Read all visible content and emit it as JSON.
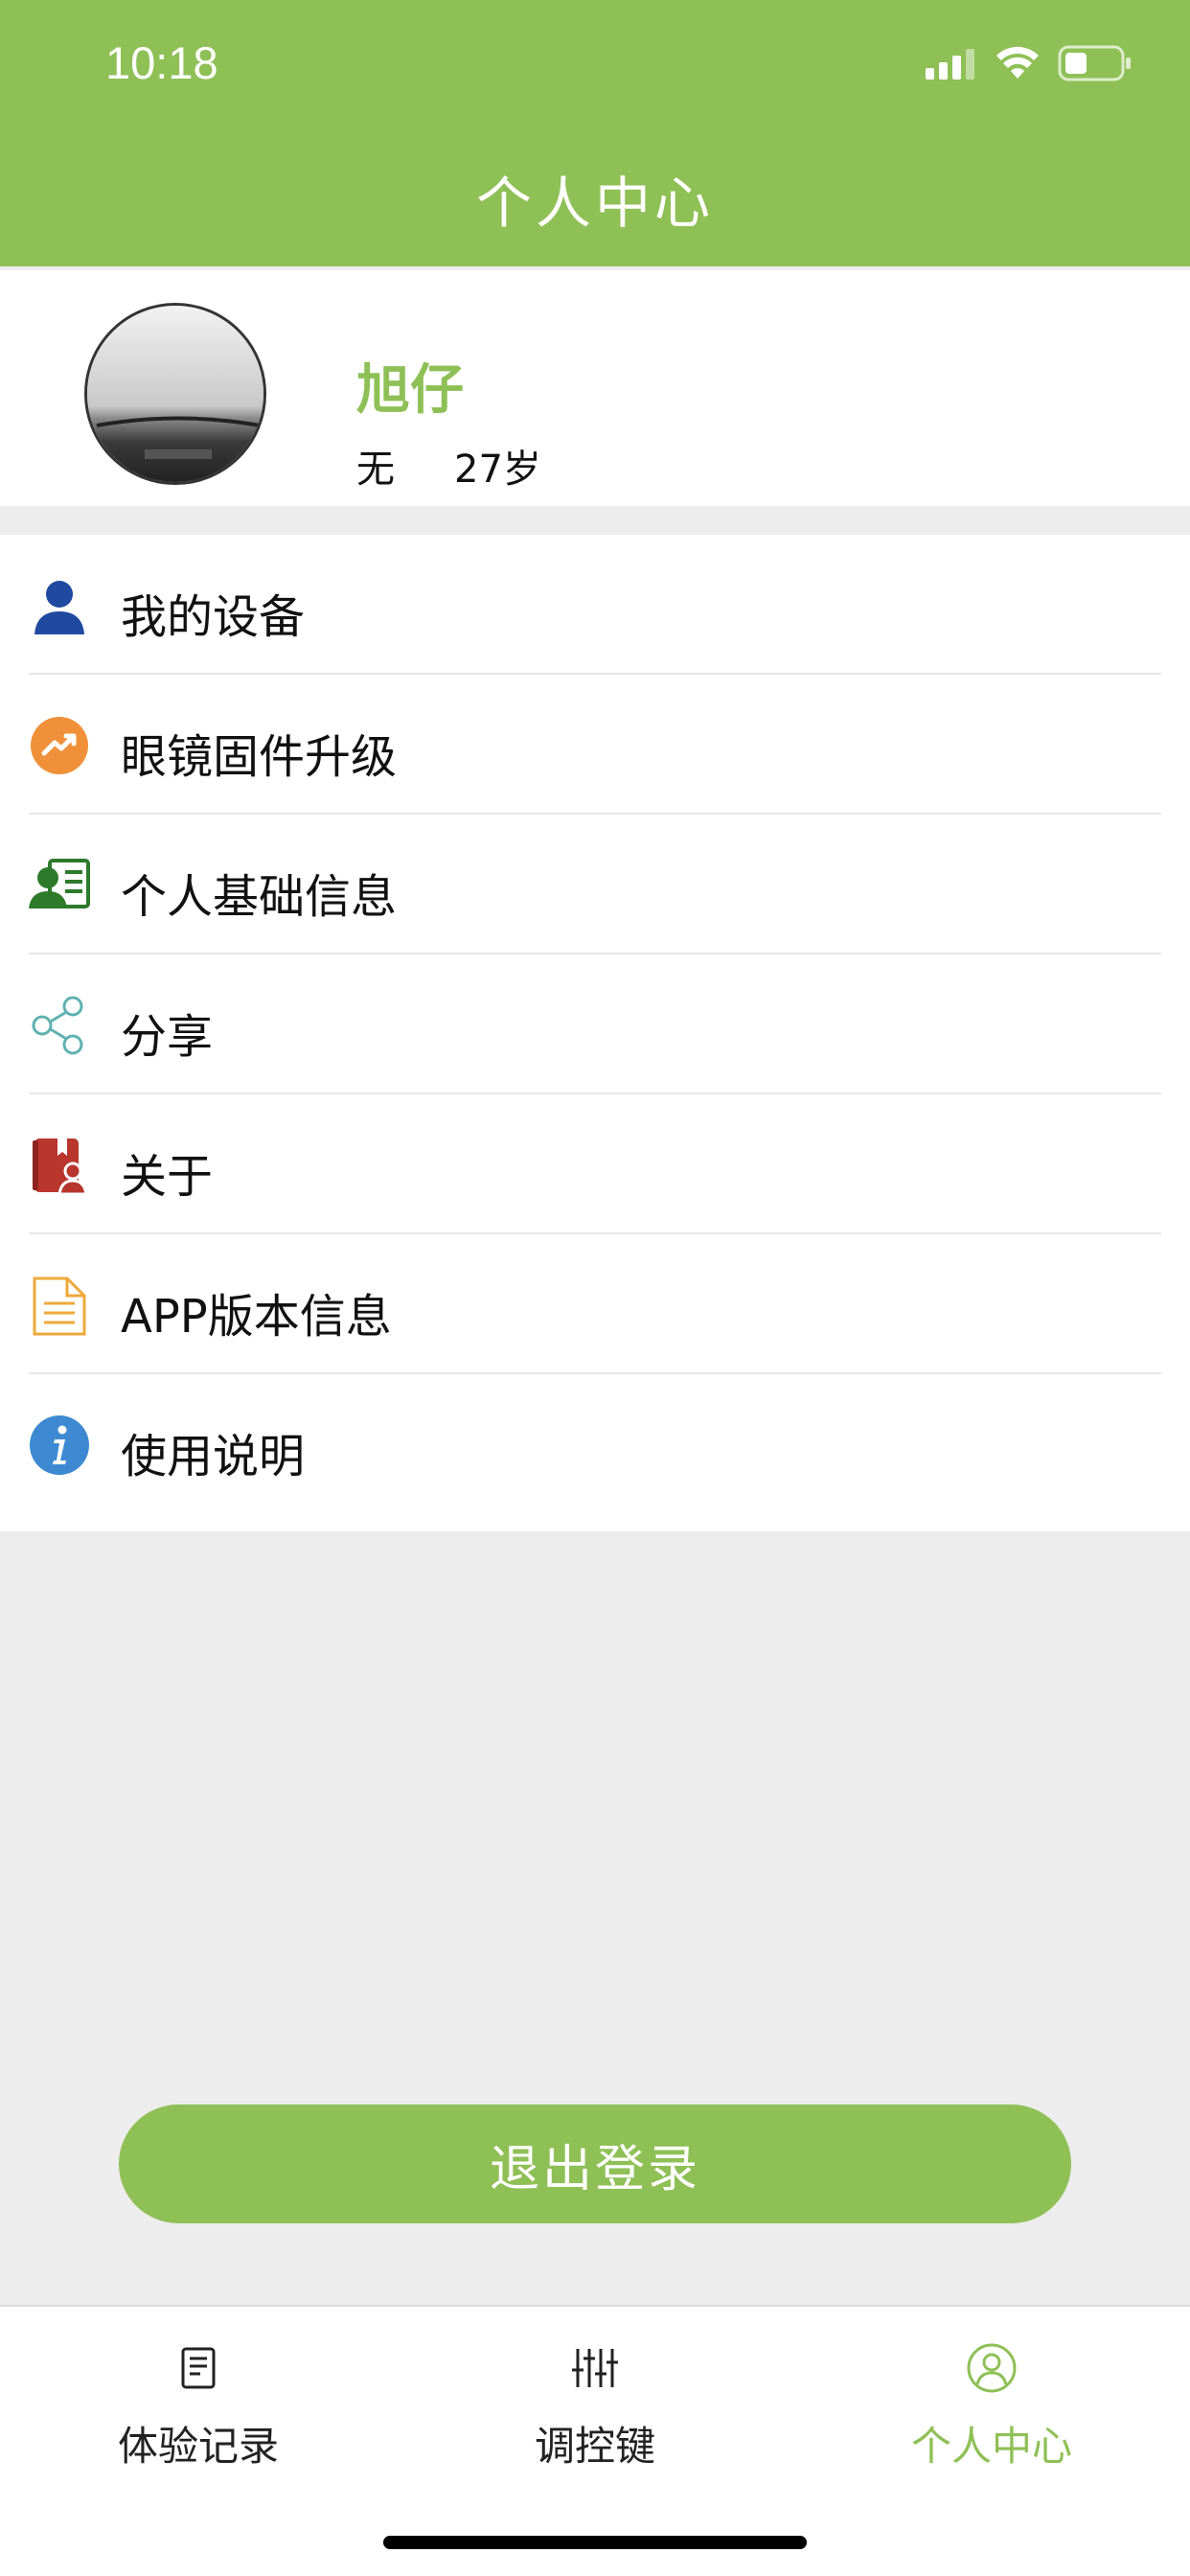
{
  "status_bar": {
    "time": "10:18"
  },
  "header": {
    "title": "个人中心"
  },
  "profile": {
    "name": "旭仔",
    "gender": "无",
    "age": "27岁"
  },
  "menu": {
    "items": [
      {
        "label": "我的设备",
        "icon": "user-icon"
      },
      {
        "label": "眼镜固件升级",
        "icon": "trend-up-icon"
      },
      {
        "label": "个人基础信息",
        "icon": "id-card-icon"
      },
      {
        "label": "分享",
        "icon": "share-icon"
      },
      {
        "label": "关于",
        "icon": "about-book-icon"
      },
      {
        "label": "APP版本信息",
        "icon": "document-icon"
      },
      {
        "label": "使用说明",
        "icon": "info-icon"
      }
    ]
  },
  "logout": {
    "label": "退出登录"
  },
  "tabbar": {
    "tabs": [
      {
        "label": "体验记录",
        "icon": "record-icon"
      },
      {
        "label": "调控键",
        "icon": "sliders-icon"
      },
      {
        "label": "个人中心",
        "icon": "profile-icon",
        "active": true
      }
    ]
  },
  "colors": {
    "accent": "#8fc056",
    "background": "#ededed"
  }
}
